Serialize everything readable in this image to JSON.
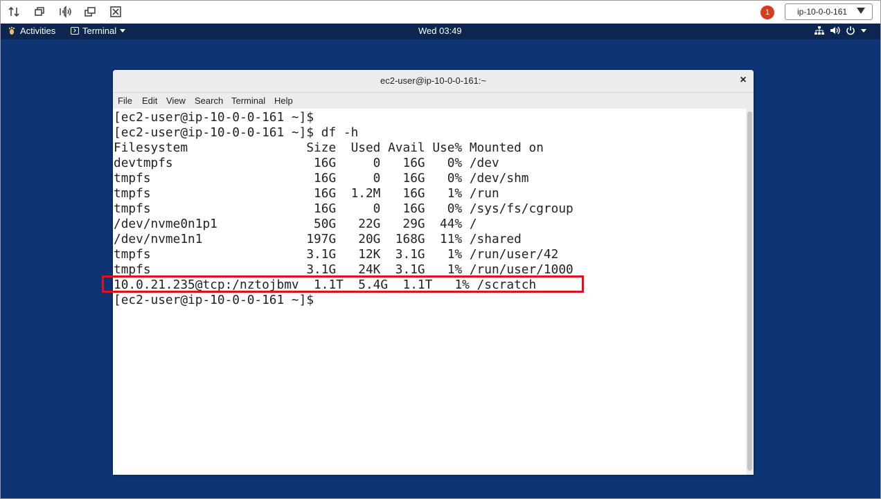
{
  "outer_toolbar": {
    "icons": [
      "sort-icon",
      "restore-icon",
      "audio-icon",
      "multi-window-icon",
      "fullscreen-icon"
    ],
    "notification_count": "1",
    "host_select": "ip-10-0-0-161"
  },
  "topbar": {
    "activities": "Activities",
    "app_menu": "Terminal",
    "clock": "Wed 03:49"
  },
  "window": {
    "title": "ec2-user@ip-10-0-0-161:~",
    "menu": [
      "File",
      "Edit",
      "View",
      "Search",
      "Terminal",
      "Help"
    ],
    "lines": [
      "[ec2-user@ip-10-0-0-161 ~]$",
      "[ec2-user@ip-10-0-0-161 ~]$ df -h",
      "Filesystem                Size  Used Avail Use% Mounted on",
      "devtmpfs                   16G     0   16G   0% /dev",
      "tmpfs                      16G     0   16G   0% /dev/shm",
      "tmpfs                      16G  1.2M   16G   1% /run",
      "tmpfs                      16G     0   16G   0% /sys/fs/cgroup",
      "/dev/nvme0n1p1             50G   22G   29G  44% /",
      "/dev/nvme1n1              197G   20G  168G  11% /shared",
      "tmpfs                     3.1G   12K  3.1G   1% /run/user/42",
      "tmpfs                     3.1G   24K  3.1G   1% /run/user/1000",
      "10.0.21.235@tcp:/nztojbmv  1.1T  5.4G  1.1T   1% /scratch",
      "[ec2-user@ip-10-0-0-161 ~]$"
    ]
  },
  "colors": {
    "desktop_bg": "#0e3475",
    "topbar_bg": "#0c2650",
    "highlight_border": "#e0101c",
    "notification_badge": "#d93b1e"
  }
}
